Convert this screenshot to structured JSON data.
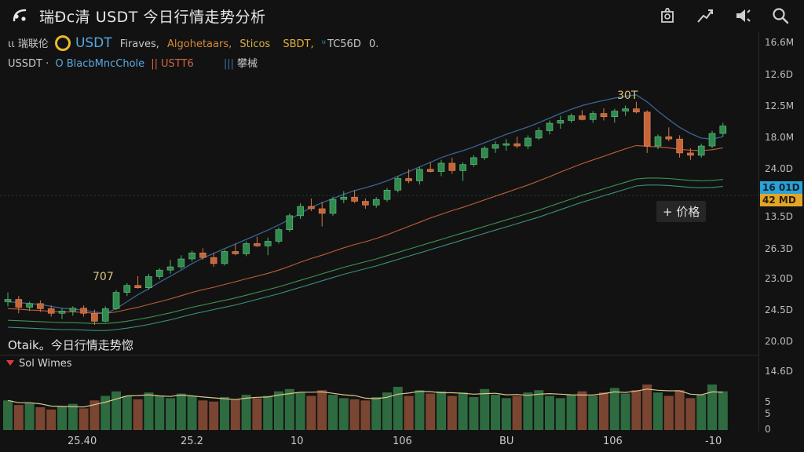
{
  "header": {
    "title": "瑞Ðc清 USDT  今日行情走势分析"
  },
  "toolbar": {
    "icons": [
      "screenshot-icon",
      "draw-trend-icon",
      "alerts-icon",
      "search-icon"
    ]
  },
  "legend": {
    "row1": {
      "prefix": "ιι 瑞联伦",
      "symbol": "USDT",
      "items": [
        "Firaves,",
        "Algohetaars,",
        "Sticos"
      ],
      "sbdt": "SBDT,",
      "tc": "TC56D",
      "tail": "0."
    },
    "row2": {
      "pair": "USSDT ·",
      "indicator": "O BlacbMncChole",
      "ustt": "USTT6",
      "extra": "攀械"
    }
  },
  "y_axis_main": [
    "16.6M",
    "12.6D",
    "12.5M",
    "18.0M",
    "24.0D",
    "13.5D",
    "26.3D",
    "23.0D",
    "24.5D",
    "20.0D"
  ],
  "price_tags": {
    "blue": "16 01D",
    "orange": "42 MD"
  },
  "annotations": {
    "peak_label": "30T",
    "low_label": "707",
    "crosshair": "+ 价格",
    "bottom_note": "Otaik。今日行情走势惚"
  },
  "volume_panel": {
    "title": "Sol Wimes",
    "y_axis": [
      "14.6D",
      "5",
      "5",
      "0"
    ]
  },
  "x_axis": [
    "25.40",
    "25.2",
    "10",
    "106",
    "BU",
    "106",
    "-10"
  ],
  "colors": {
    "up": "#2f8a4e",
    "down": "#c7653a",
    "ma_orange": "#d0683c",
    "ma_green": "#45a35a",
    "ma_blue": "#3e6ea0",
    "vol_up": "#2e6b40",
    "vol_down": "#7a4632",
    "tag_blue": "#2ba1d6",
    "tag_orange": "#e2a52a"
  },
  "chart_data": {
    "type": "candlestick",
    "candles": [
      [
        600,
        620,
        590,
        605
      ],
      [
        605,
        612,
        575,
        588
      ],
      [
        588,
        600,
        580,
        596
      ],
      [
        596,
        603,
        578,
        585
      ],
      [
        585,
        592,
        568,
        575
      ],
      [
        575,
        585,
        563,
        580
      ],
      [
        580,
        590,
        570,
        586
      ],
      [
        586,
        592,
        568,
        575
      ],
      [
        575,
        583,
        550,
        558
      ],
      [
        558,
        590,
        556,
        585
      ],
      [
        585,
        625,
        582,
        620
      ],
      [
        620,
        640,
        612,
        635
      ],
      [
        635,
        655,
        628,
        630
      ],
      [
        630,
        660,
        626,
        654
      ],
      [
        654,
        672,
        648,
        668
      ],
      [
        668,
        690,
        660,
        675
      ],
      [
        675,
        700,
        670,
        692
      ],
      [
        692,
        710,
        686,
        705
      ],
      [
        705,
        715,
        690,
        695
      ],
      [
        695,
        705,
        675,
        682
      ],
      [
        682,
        712,
        678,
        708
      ],
      [
        708,
        725,
        700,
        703
      ],
      [
        703,
        730,
        698,
        725
      ],
      [
        725,
        740,
        718,
        720
      ],
      [
        720,
        738,
        700,
        730
      ],
      [
        730,
        760,
        725,
        755
      ],
      [
        755,
        790,
        750,
        785
      ],
      [
        785,
        812,
        778,
        805
      ],
      [
        805,
        822,
        795,
        800
      ],
      [
        800,
        815,
        762,
        790
      ],
      [
        790,
        826,
        785,
        820
      ],
      [
        820,
        838,
        812,
        825
      ],
      [
        825,
        840,
        812,
        816
      ],
      [
        816,
        822,
        800,
        808
      ],
      [
        808,
        825,
        802,
        820
      ],
      [
        820,
        845,
        815,
        840
      ],
      [
        840,
        870,
        835,
        865
      ],
      [
        865,
        885,
        855,
        860
      ],
      [
        860,
        890,
        852,
        885
      ],
      [
        885,
        900,
        878,
        880
      ],
      [
        880,
        905,
        870,
        898
      ],
      [
        898,
        910,
        875,
        882
      ],
      [
        882,
        900,
        860,
        895
      ],
      [
        895,
        915,
        890,
        910
      ],
      [
        910,
        935,
        905,
        930
      ],
      [
        930,
        945,
        920,
        938
      ],
      [
        938,
        950,
        925,
        940
      ],
      [
        940,
        955,
        930,
        935
      ],
      [
        935,
        958,
        928,
        952
      ],
      [
        952,
        975,
        948,
        968
      ],
      [
        968,
        990,
        960,
        984
      ],
      [
        984,
        1000,
        972,
        990
      ],
      [
        990,
        1005,
        985,
        1000
      ],
      [
        1000,
        1012,
        990,
        992
      ],
      [
        992,
        1010,
        985,
        1005
      ],
      [
        1005,
        1016,
        990,
        998
      ],
      [
        998,
        1015,
        985,
        1010
      ],
      [
        1010,
        1022,
        1000,
        1015
      ],
      [
        1015,
        1030,
        1005,
        1008
      ],
      [
        1008,
        1012,
        920,
        935
      ],
      [
        935,
        960,
        928,
        955
      ],
      [
        955,
        975,
        945,
        950
      ],
      [
        950,
        958,
        910,
        920
      ],
      [
        920,
        930,
        905,
        915
      ],
      [
        915,
        940,
        910,
        935
      ],
      [
        935,
        968,
        930,
        962
      ],
      [
        962,
        985,
        955,
        978
      ]
    ],
    "series": [
      {
        "values": [
          585,
          584,
          582,
          581,
          579,
          578,
          578,
          577,
          575,
          575,
          578,
          583,
          588,
          594,
          600,
          606,
          613,
          620,
          626,
          631,
          637,
          643,
          649,
          655,
          661,
          668,
          676,
          685,
          693,
          700,
          708,
          716,
          723,
          729,
          736,
          744,
          753,
          762,
          771,
          780,
          788,
          796,
          803,
          811,
          819,
          827,
          835,
          843,
          851,
          860,
          869,
          879,
          888,
          897,
          905,
          913,
          921,
          929,
          936,
          934,
          933,
          931,
          928,
          926,
          925,
          927,
          931
        ]
      },
      {
        "values": [
          560,
          559,
          558,
          557,
          556,
          555,
          555,
          554,
          553,
          553,
          555,
          558,
          562,
          566,
          571,
          576,
          582,
          588,
          593,
          598,
          603,
          608,
          614,
          620,
          626,
          632,
          639,
          646,
          653,
          660,
          667,
          674,
          680,
          686,
          692,
          699,
          706,
          713,
          720,
          727,
          734,
          741,
          748,
          755,
          762,
          769,
          776,
          783,
          790,
          797,
          805,
          813,
          821,
          829,
          836,
          843,
          850,
          857,
          864,
          866,
          866,
          865,
          863,
          861,
          860,
          861,
          863
        ]
      },
      {
        "values": [
          600,
          598,
          596,
          594,
          590,
          586,
          584,
          582,
          578,
          575,
          585,
          600,
          615,
          628,
          642,
          655,
          668,
          682,
          694,
          704,
          714,
          724,
          734,
          744,
          754,
          765,
          777,
          790,
          803,
          813,
          822,
          831,
          839,
          845,
          852,
          860,
          870,
          880,
          890,
          900,
          910,
          918,
          925,
          933,
          942,
          951,
          960,
          968,
          976,
          985,
          995,
          1005,
          1014,
          1022,
          1028,
          1033,
          1038,
          1042,
          1045,
          1030,
          1010,
          992,
          975,
          962,
          952,
          950,
          955
        ]
      },
      {
        "values": [
          545,
          544,
          543,
          542,
          541,
          540,
          540,
          539,
          538,
          538,
          540,
          543,
          547,
          551,
          556,
          561,
          567,
          573,
          578,
          583,
          588,
          593,
          599,
          605,
          611,
          617,
          624,
          631,
          638,
          645,
          652,
          659,
          665,
          671,
          677,
          684,
          691,
          698,
          705,
          712,
          719,
          726,
          733,
          740,
          747,
          754,
          761,
          768,
          775,
          782,
          790,
          798,
          806,
          814,
          821,
          828,
          835,
          842,
          849,
          851,
          851,
          850,
          848,
          846,
          845,
          846,
          848
        ]
      }
    ],
    "volume": [
      26,
      22,
      24,
      20,
      18,
      21,
      23,
      19,
      26,
      30,
      34,
      30,
      27,
      33,
      30,
      28,
      32,
      30,
      26,
      25,
      29,
      27,
      31,
      28,
      30,
      34,
      36,
      33,
      30,
      35,
      31,
      28,
      27,
      26,
      29,
      33,
      38,
      30,
      35,
      32,
      34,
      30,
      33,
      29,
      36,
      31,
      28,
      30,
      33,
      35,
      30,
      28,
      31,
      34,
      30,
      33,
      37,
      32,
      35,
      40,
      33,
      30,
      35,
      28,
      31,
      40,
      34
    ]
  }
}
